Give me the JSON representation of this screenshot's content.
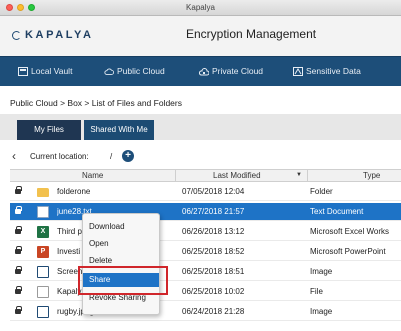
{
  "window": {
    "title": "Kapalya"
  },
  "brand": {
    "logo_text": "KAPALYA",
    "app_title": "Encryption Management"
  },
  "nav": {
    "items": [
      {
        "label": "Local Vault",
        "icon": "vault-icon"
      },
      {
        "label": "Public Cloud",
        "icon": "cloud-icon"
      },
      {
        "label": "Private Cloud",
        "icon": "private-cloud-icon"
      },
      {
        "label": "Sensitive Data",
        "icon": "sensitive-data-icon"
      }
    ]
  },
  "breadcrumb": "Public Cloud > Box > List of Files and Folders",
  "tabs": [
    {
      "label": "My Files"
    },
    {
      "label": "Shared With Me"
    }
  ],
  "location": {
    "label": "Current location:",
    "path": "/"
  },
  "table": {
    "columns": {
      "name": "Name",
      "last_modified": "Last Modified",
      "type": "Type"
    },
    "rows": [
      {
        "name": "folderone",
        "date": "07/05/2018 12:04",
        "type": "Folder",
        "icon": "folder"
      },
      {
        "name": "june28.txt",
        "date": "06/27/2018 21:57",
        "type": "Text Document",
        "icon": "doc"
      },
      {
        "name": "Third p",
        "date": "06/26/2018 13:12",
        "type": "Microsoft Excel Works",
        "icon": "excel"
      },
      {
        "name": "Investi",
        "date": "06/25/2018 18:52",
        "type": "Microsoft PowerPoint",
        "icon": "ppt"
      },
      {
        "name": "Screen",
        "date": "06/25/2018 18:51",
        "type": "Image",
        "icon": "image"
      },
      {
        "name": "Kapaly",
        "date": "06/25/2018 10:02",
        "type": "File",
        "icon": "file"
      },
      {
        "name": "rugby.jpeg",
        "date": "06/24/2018 21:28",
        "type": "Image",
        "icon": "image"
      }
    ]
  },
  "context_menu": {
    "items": [
      {
        "label": "Download"
      },
      {
        "label": "Open"
      },
      {
        "label": "Delete"
      },
      {
        "label": "Share"
      },
      {
        "label": "Revoke Sharing"
      }
    ]
  },
  "colors": {
    "nav_bg": "#1d4e79",
    "selection": "#1e73c6",
    "highlight_outline": "#d0262b"
  }
}
